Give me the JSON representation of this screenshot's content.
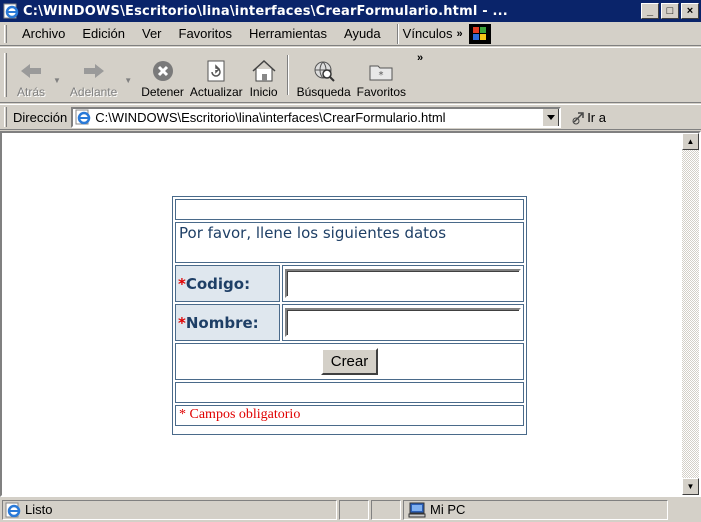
{
  "window": {
    "title": "C:\\WINDOWS\\Escritorio\\lina\\interfaces\\CrearFormulario.html - ...",
    "buttons": [
      "_",
      "□",
      "×"
    ]
  },
  "menu": {
    "items": [
      {
        "label": "Archivo"
      },
      {
        "label": "Edición"
      },
      {
        "label": "Ver"
      },
      {
        "label": "Favoritos"
      },
      {
        "label": "Herramientas"
      },
      {
        "label": "Ayuda"
      }
    ],
    "links_label": "Vínculos",
    "links_chevron": "»"
  },
  "toolbar": {
    "back": "Atrás",
    "forward": "Adelante",
    "stop": "Detener",
    "refresh": "Actualizar",
    "home": "Inicio",
    "search": "Búsqueda",
    "favorites": "Favoritos",
    "more": "»"
  },
  "address": {
    "label": "Dirección",
    "url": "C:\\WINDOWS\\Escritorio\\lina\\interfaces\\CrearFormulario.html",
    "go_label": "Ir a"
  },
  "form": {
    "message": "Por favor, llene los siguientes datos",
    "required_mark": "*",
    "fields": [
      {
        "label": "Codigo:",
        "value": ""
      },
      {
        "label": "Nombre:",
        "value": ""
      }
    ],
    "submit_label": "Crear",
    "footnote": "* Campos obligatorio"
  },
  "status": {
    "text": "Listo",
    "zone": "Mi PC"
  },
  "colors": {
    "titlebar": "#0a246a",
    "chrome": "#d4d0c8",
    "form_border": "#4a6a8a",
    "required": "#e00000"
  }
}
